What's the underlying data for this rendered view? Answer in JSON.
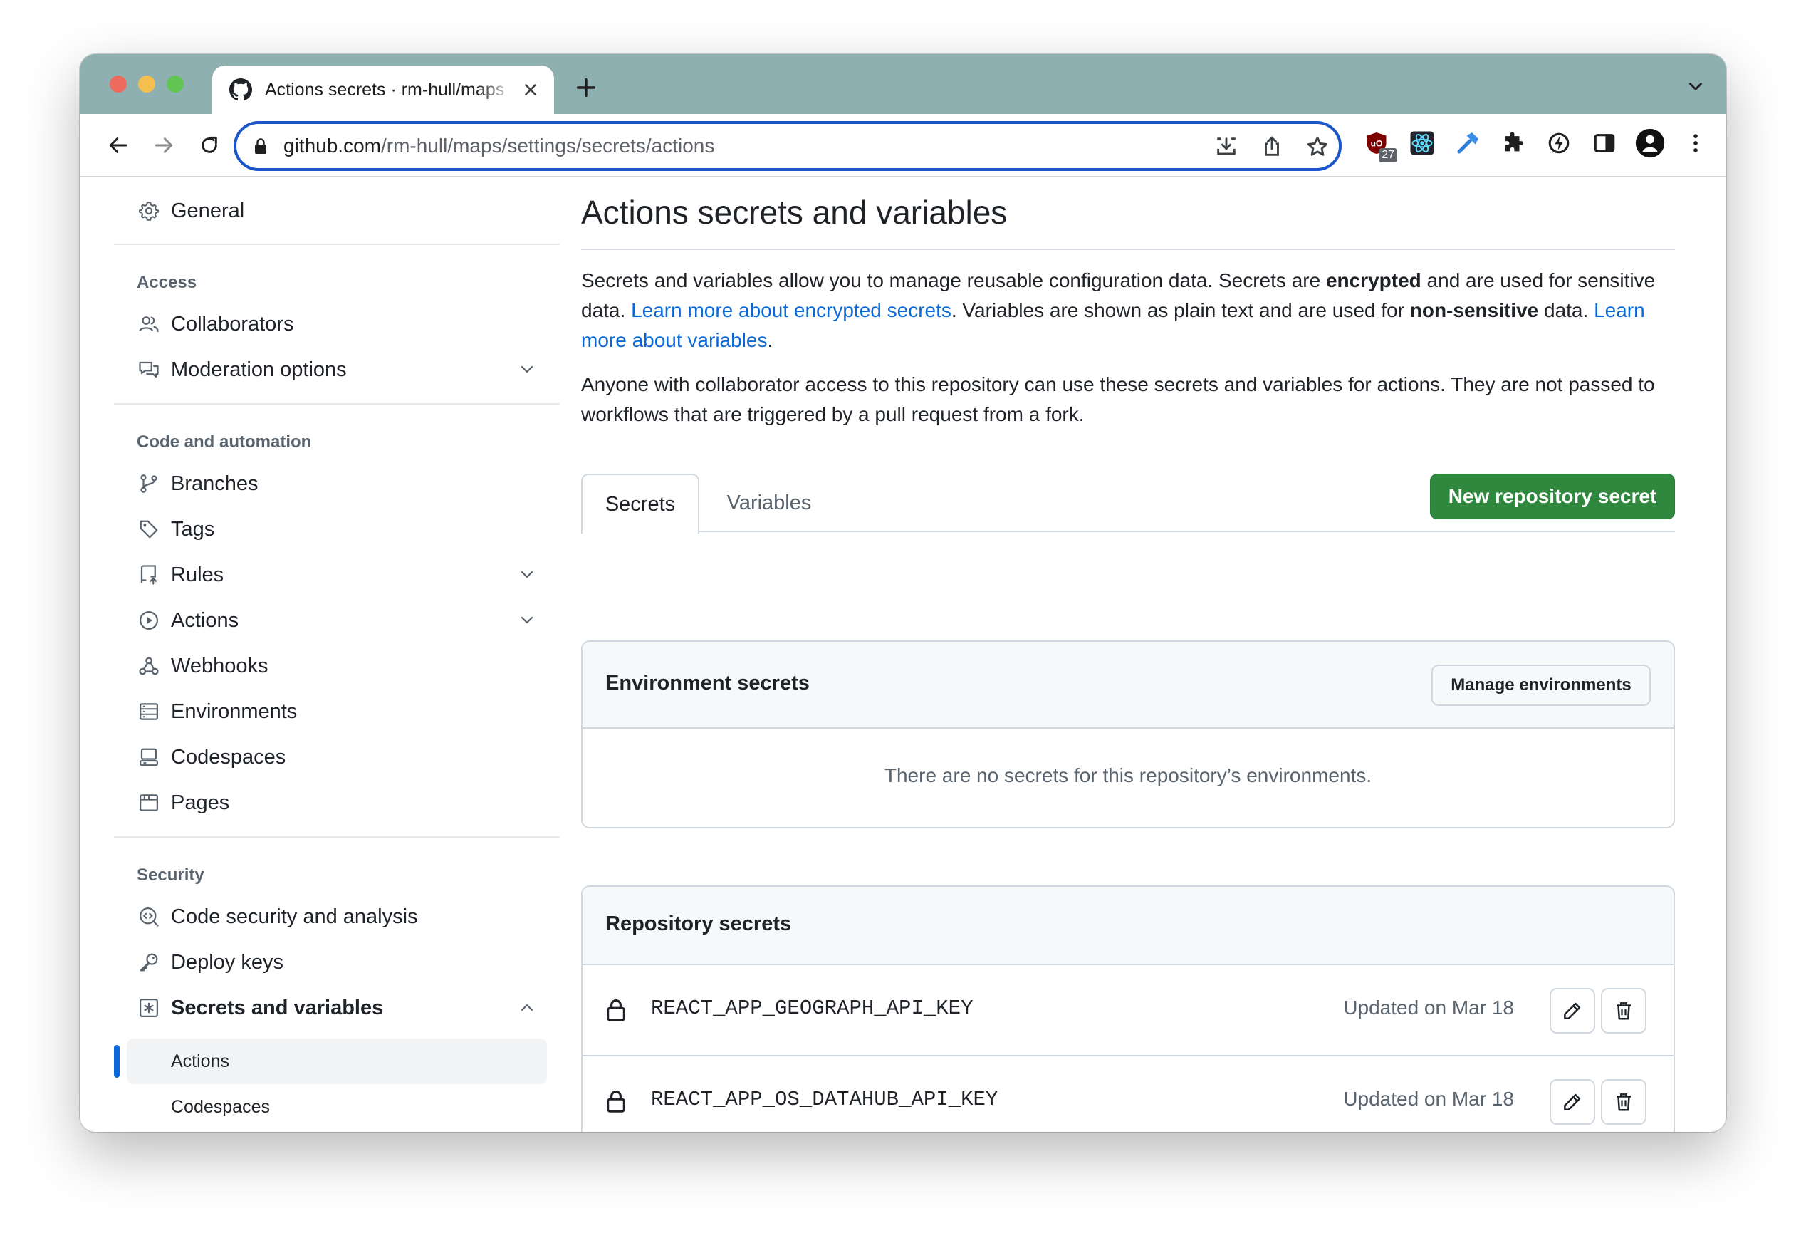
{
  "browser": {
    "tab_title": "Actions secrets · rm-hull/maps",
    "url_host": "github.com",
    "url_path": "/rm-hull/maps/settings/secrets/actions",
    "extension_badge": "27"
  },
  "sidebar": {
    "general": "General",
    "access_label": "Access",
    "collaborators": "Collaborators",
    "moderation": "Moderation options",
    "code_label": "Code and automation",
    "branches": "Branches",
    "tags": "Tags",
    "rules": "Rules",
    "actions": "Actions",
    "webhooks": "Webhooks",
    "environments": "Environments",
    "codespaces": "Codespaces",
    "pages": "Pages",
    "security_label": "Security",
    "code_security": "Code security and analysis",
    "deploy_keys": "Deploy keys",
    "secrets_vars": "Secrets and variables",
    "sub_actions": "Actions",
    "sub_codespaces": "Codespaces"
  },
  "main": {
    "title": "Actions secrets and variables",
    "p1_a": "Secrets and variables allow you to manage reusable configuration data. Secrets are ",
    "p1_b": "encrypted",
    "p1_c": " and are used for sensitive data. ",
    "p1_link1": "Learn more about encrypted secrets",
    "p1_d": ". Variables are shown as plain text and are used for ",
    "p1_e": "non-sensitive",
    "p1_f": " data. ",
    "p1_link2": "Learn more about variables",
    "p1_g": ".",
    "p2": "Anyone with collaborator access to this repository can use these secrets and variables for actions. They are not passed to workflows that are triggered by a pull request from a fork.",
    "tab_secrets": "Secrets",
    "tab_variables": "Variables",
    "new_secret_btn": "New repository secret",
    "env_title": "Environment secrets",
    "manage_env_btn": "Manage environments",
    "env_empty": "There are no secrets for this repository’s environments.",
    "repo_title": "Repository secrets",
    "secrets": [
      {
        "name": "REACT_APP_GEOGRAPH_API_KEY",
        "updated": "Updated on Mar 18"
      },
      {
        "name": "REACT_APP_OS_DATAHUB_API_KEY",
        "updated": "Updated on Mar 18"
      }
    ]
  },
  "colors": {
    "accent": "#0969da",
    "primary_button": "#2f883d",
    "tabstrip": "#8fb0b0"
  }
}
